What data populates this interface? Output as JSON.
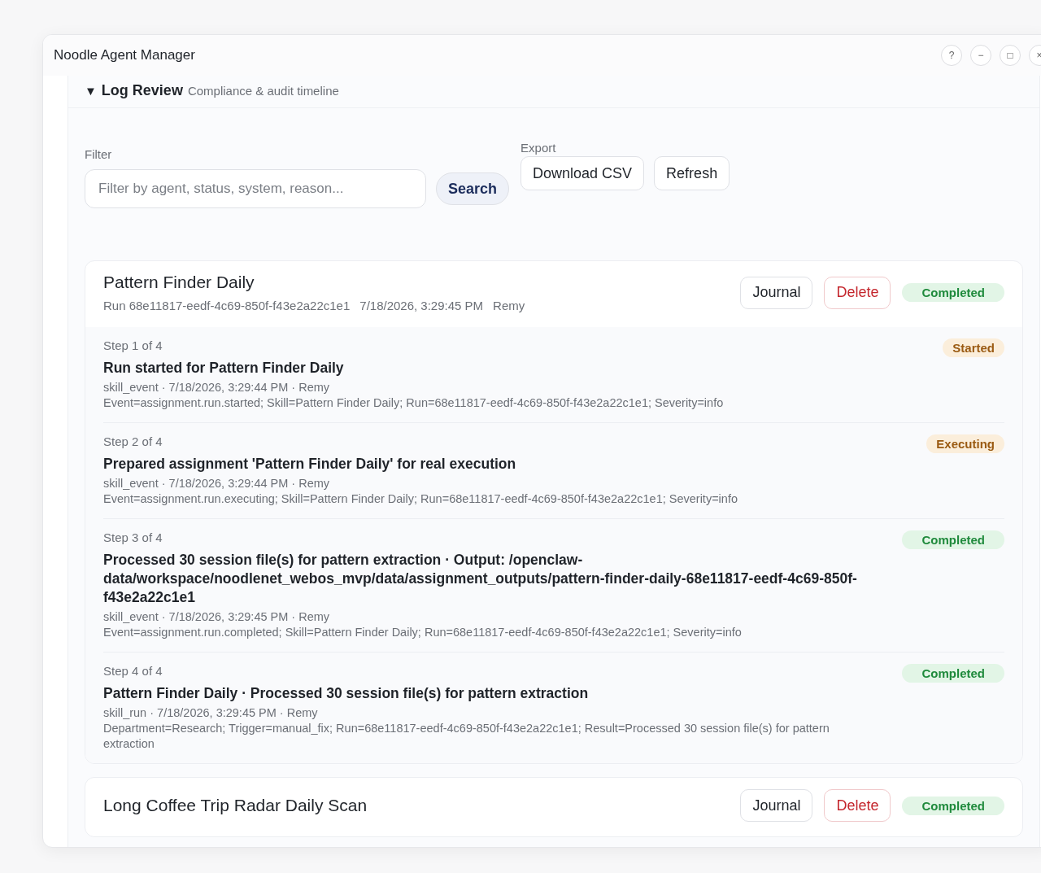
{
  "window": {
    "title": "Noodle Agent Manager",
    "controls": [
      "?",
      "−",
      "□",
      "×"
    ]
  },
  "section": {
    "expanded": true,
    "toggle": "▼",
    "title": "Log Review",
    "subtitle": "Compliance & audit timeline"
  },
  "filter": {
    "label": "Filter",
    "placeholder": "Filter by agent, status, system, reason...",
    "button": "Search"
  },
  "export": {
    "label": "Export",
    "buttons": [
      "Download CSV",
      "Refresh"
    ]
  },
  "runs": [
    {
      "title": "Pattern Finder Daily",
      "meta": [
        "Run 68e11817-eedf-4c69-850f-f43e2a22c1e1",
        "7/18/2026, 3:29:45 PM",
        "Remy"
      ],
      "journal": "Journal",
      "delete": "Delete",
      "status": {
        "label": "Completed",
        "kind": "success"
      },
      "steps": [
        {
          "step": "Step 1 of 4",
          "title": "Run started for Pattern Finder Daily",
          "meta": "skill_event · 7/18/2026, 3:29:44 PM · Remy",
          "detail": "Event=assignment.run.started; Skill=Pattern Finder Daily; Run=68e11817-eedf-4c69-850f-f43e2a22c1e1; Severity=info",
          "status": {
            "label": "Started",
            "kind": "warning"
          }
        },
        {
          "step": "Step 2 of 4",
          "title": "Prepared assignment 'Pattern Finder Daily' for real execution",
          "meta": "skill_event · 7/18/2026, 3:29:44 PM · Remy",
          "detail": "Event=assignment.run.executing; Skill=Pattern Finder Daily; Run=68e11817-eedf-4c69-850f-f43e2a22c1e1; Severity=info",
          "status": {
            "label": "Executing",
            "kind": "warning"
          }
        },
        {
          "step": "Step 3 of 4",
          "title": "Processed 30 session file(s) for pattern extraction · Output: /openclaw-data/workspace/noodlenet_webos_mvp/data/assignment_outputs/pattern-finder-daily-68e11817-eedf-4c69-850f-f43e2a22c1e1",
          "meta": "skill_event · 7/18/2026, 3:29:45 PM · Remy",
          "detail": "Event=assignment.run.completed; Skill=Pattern Finder Daily; Run=68e11817-eedf-4c69-850f-f43e2a22c1e1; Severity=info",
          "status": {
            "label": "Completed",
            "kind": "success"
          }
        },
        {
          "step": "Step 4 of 4",
          "title": "Pattern Finder Daily · Processed 30 session file(s) for pattern extraction",
          "meta": "skill_run · 7/18/2026, 3:29:45 PM · Remy",
          "detail": "Department=Research; Trigger=manual_fix; Run=68e11817-eedf-4c69-850f-f43e2a22c1e1; Result=Processed 30 session file(s) for pattern extraction",
          "status": {
            "label": "Completed",
            "kind": "success"
          }
        }
      ]
    },
    {
      "title": "Long Coffee Trip Radar Daily Scan",
      "journal": "Journal",
      "delete": "Delete",
      "status": {
        "label": "Completed",
        "kind": "success"
      }
    }
  ]
}
